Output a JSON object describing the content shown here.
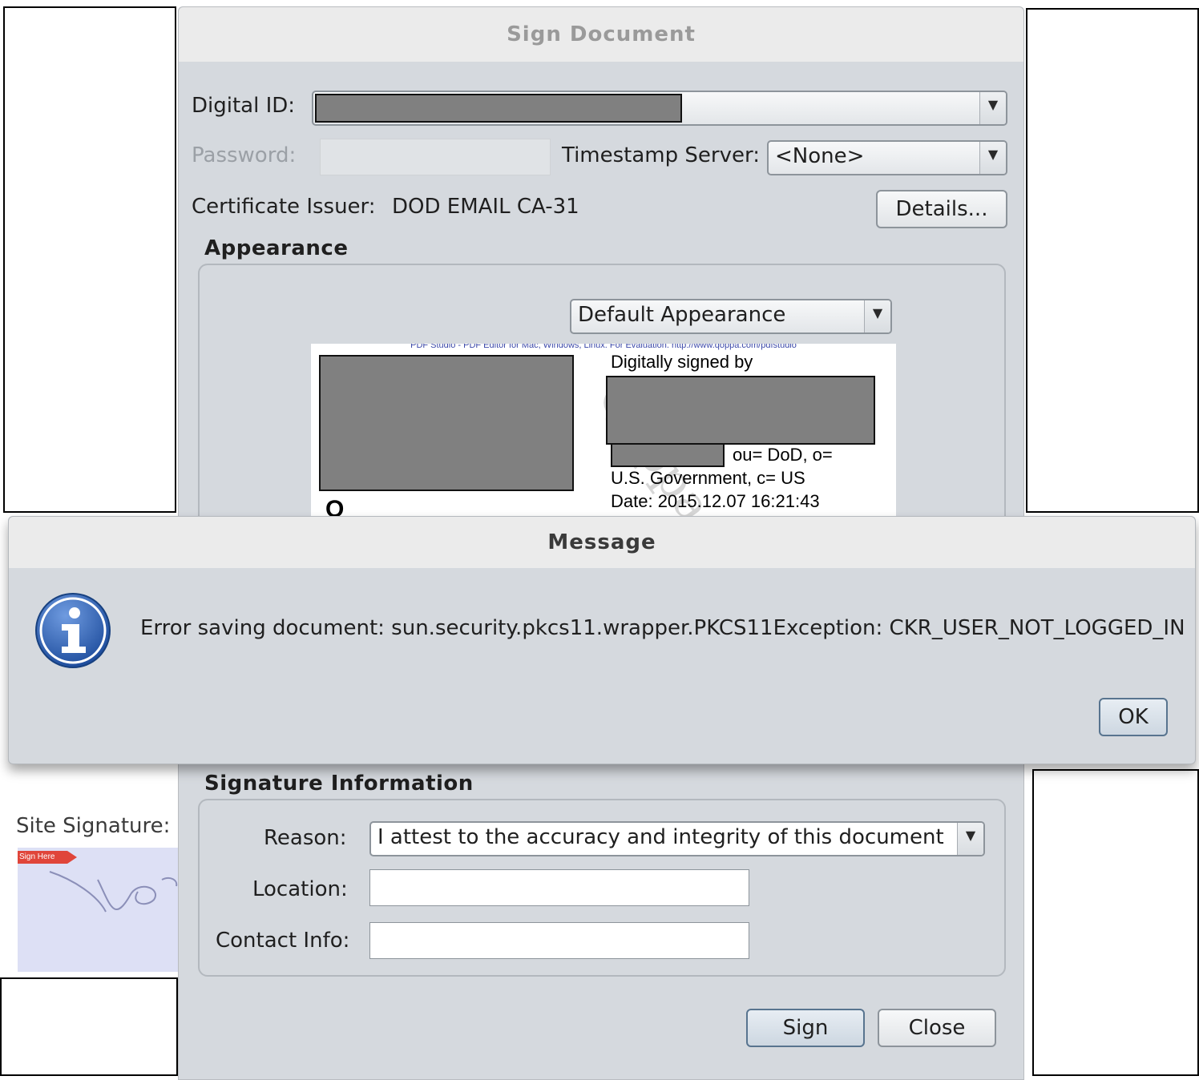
{
  "sign_dialog": {
    "title": "Sign Document",
    "digital_id_label": "Digital ID:",
    "password_label": "Password:",
    "timestamp_label": "Timestamp Server:",
    "timestamp_value": "<None>",
    "issuer_label": "Certificate Issuer:",
    "issuer_value": "DOD EMAIL CA-31",
    "details_button": "Details...",
    "appearance_title": "Appearance",
    "appearance_value": "Default Appearance",
    "preview": {
      "banner": "PDF Studio - PDF Editor for Mac, Windows, Linux. For Evaluation. http://www.qoppa.com/pdfstudio",
      "signed_by": "Digitally signed by",
      "line_ou": "ou= DoD, o=",
      "line_gov": "U.S. Government, c= US",
      "line_date": "Date: 2015.12.07 16:21:43",
      "watermark": "Qoppa",
      "initial": "Q"
    },
    "signature_info_title": "Signature Information",
    "reason_label": "Reason:",
    "reason_value": "I attest to the accuracy and integrity of this document",
    "location_label": "Location:",
    "contact_label": "Contact Info:",
    "sign_button": "Sign",
    "close_button": "Close"
  },
  "message_dialog": {
    "title": "Message",
    "text": "Error saving document: sun.security.pkcs11.wrapper.PKCS11Exception: CKR_USER_NOT_LOGGED_IN",
    "ok_button": "OK",
    "icon": "info-icon"
  },
  "background": {
    "site_signature_label": "Site Signature:",
    "sign_here_tag": "Sign Here"
  },
  "colors": {
    "dialog_bg": "#d5d9de",
    "title_bar": "#ebebeb",
    "redaction": "#808080",
    "info_blue": "#2f5fb0"
  }
}
